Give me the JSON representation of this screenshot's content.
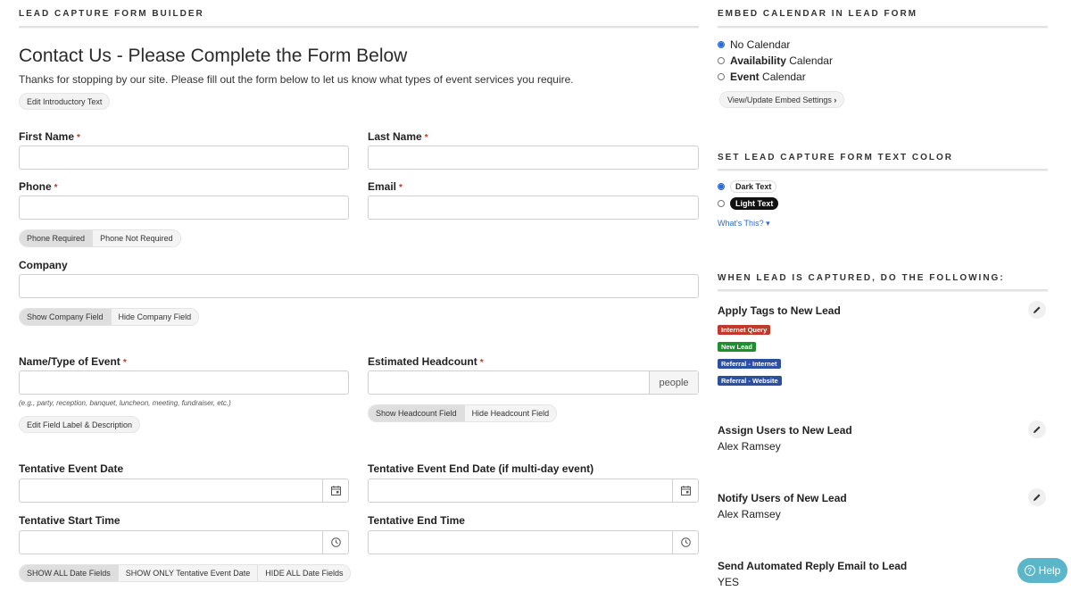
{
  "left": {
    "section_title": "LEAD CAPTURE FORM BUILDER",
    "heading": "Contact Us - Please Complete the Form Below",
    "intro": "Thanks for stopping by our site. Please fill out the form below to let us know what types of event services you require.",
    "edit_intro_btn": "Edit Introductory Text",
    "required_mark": "*",
    "first_name_label": "First Name",
    "last_name_label": "Last Name",
    "phone_label": "Phone",
    "email_label": "Email",
    "phone_required": "Phone Required",
    "phone_not_required": "Phone Not Required",
    "company_label": "Company",
    "show_company": "Show Company Field",
    "hide_company": "Hide Company Field",
    "event_type_label": "Name/Type of Event",
    "event_type_hint": "(e.g., party, reception, banquet, luncheon, meeting, fundraiser, etc.)",
    "edit_field_btn": "Edit Field Label & Description",
    "headcount_label": "Estimated Headcount",
    "headcount_addon": "people",
    "show_headcount": "Show Headcount Field",
    "hide_headcount": "Hide Headcount Field",
    "event_date_label": "Tentative Event Date",
    "event_end_date_label": "Tentative Event End Date (if multi-day event)",
    "start_time_label": "Tentative Start Time",
    "end_time_label": "Tentative End Time",
    "show_all_dates": "SHOW ALL Date Fields",
    "show_only_event_date": "SHOW ONLY Tentative Event Date",
    "hide_all_dates": "HIDE ALL Date Fields"
  },
  "right": {
    "embed_title": "EMBED CALENDAR IN LEAD FORM",
    "calendar_options": [
      {
        "bold": "",
        "rest": "No Calendar",
        "selected": true
      },
      {
        "bold": "Availability",
        "rest": " Calendar",
        "selected": false
      },
      {
        "bold": "Event",
        "rest": " Calendar",
        "selected": false
      }
    ],
    "view_embed_btn": "View/Update Embed Settings",
    "color_title": "SET LEAD CAPTURE FORM TEXT COLOR",
    "dark_text": "Dark Text",
    "light_text": "Light Text",
    "whats_this": "What's This?",
    "captured_title": "WHEN LEAD IS CAPTURED, DO THE FOLLOWING:",
    "apply_tags_label": "Apply Tags to New Lead",
    "tags": [
      {
        "text": "Internet Query",
        "color": "#c0392b"
      },
      {
        "text": "New Lead",
        "color": "#1e8f2e"
      },
      {
        "text": "Referral - Internet",
        "color": "#2d4fa0"
      },
      {
        "text": "Referral - Website",
        "color": "#2d4fa0"
      }
    ],
    "assign_users_label": "Assign Users to New Lead",
    "assign_users_value": "Alex Ramsey",
    "notify_users_label": "Notify Users of New Lead",
    "notify_users_value": "Alex Ramsey",
    "auto_reply_label": "Send Automated Reply Email to Lead",
    "auto_reply_value": "YES"
  },
  "help_label": "Help",
  "icons": {
    "calendar": "calendar-icon",
    "clock": "clock-icon",
    "pencil": "pencil-icon",
    "chevron_right": "chevron-right-icon",
    "caret_down": "caret-down-icon",
    "help": "question-circle-icon"
  }
}
